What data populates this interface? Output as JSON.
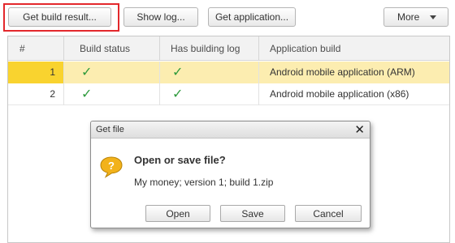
{
  "toolbar": {
    "get_build_result_label": "Get build result...",
    "show_log_label": "Show log...",
    "get_application_label": "Get application...",
    "more_label": "More"
  },
  "grid": {
    "columns": [
      "#",
      "Build status",
      "Has building log",
      "Application build"
    ],
    "rows": [
      {
        "num": "1",
        "build_status": "✓",
        "has_log": "✓",
        "application_build": "Android mobile application (ARM)",
        "selected": true
      },
      {
        "num": "2",
        "build_status": "✓",
        "has_log": "✓",
        "application_build": "Android mobile application (x86)",
        "selected": false
      }
    ]
  },
  "dialog": {
    "title": "Get file",
    "close_glyph": "✕",
    "heading": "Open or save file?",
    "filename": "My money; version 1; build 1.zip",
    "buttons": {
      "open": "Open",
      "save": "Save",
      "cancel": "Cancel"
    }
  },
  "colors": {
    "highlight_border": "#e3282c",
    "selected_row": "#fcedb0",
    "selected_num_cell": "#f9d32f",
    "check": "#2e9a3c",
    "question_icon": "#f2b21b"
  },
  "icons": {
    "check": "check-icon",
    "question": "question-icon",
    "close": "close-icon",
    "more_dropdown": "chevron-down-icon"
  }
}
